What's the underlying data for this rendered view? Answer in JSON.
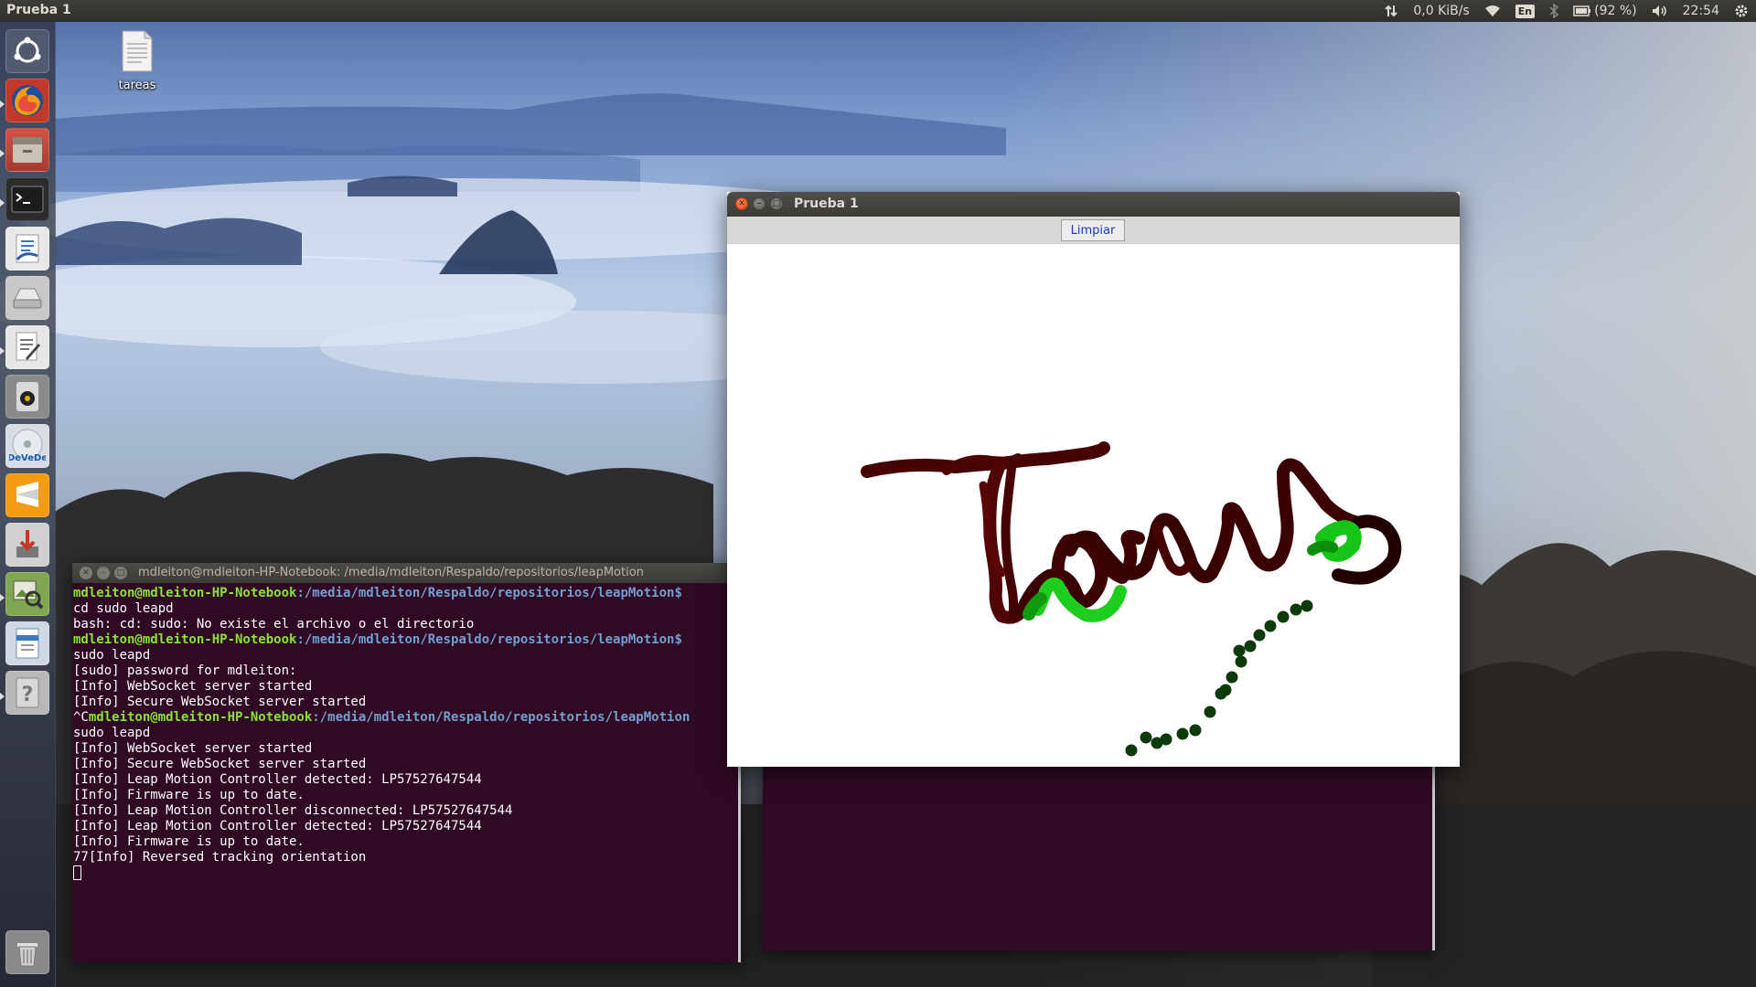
{
  "top_panel": {
    "app_title": "Prueba 1",
    "network_speed": "0,0 KiB/s",
    "keyboard_layout": "En",
    "battery_percent": "(92 %)",
    "clock": "22:54"
  },
  "launcher": {
    "items": [
      {
        "name": "dash-home-icon"
      },
      {
        "name": "firefox-icon",
        "running": true
      },
      {
        "name": "file-manager-icon",
        "running": true
      },
      {
        "name": "terminal-icon",
        "running": true
      },
      {
        "name": "text-editor-icon"
      },
      {
        "name": "drive-icon"
      },
      {
        "name": "writer-icon",
        "running": true
      },
      {
        "name": "speaker-app-icon"
      },
      {
        "name": "devede-icon"
      },
      {
        "name": "sublime-text-icon"
      },
      {
        "name": "installer-icon"
      },
      {
        "name": "image-viewer-icon",
        "running": true
      },
      {
        "name": "document-viewer-icon"
      },
      {
        "name": "help-icon",
        "running": true
      },
      {
        "name": "trash-icon"
      }
    ],
    "devede_label": "DeVeDe"
  },
  "desktop": {
    "file_label": "tareas"
  },
  "terminal": {
    "title": "mdleiton@mdleiton-HP-Notebook: /media/mdleiton/Respaldo/repositorios/leapMotion",
    "prompt_user": "mdleiton@mdleiton-HP-Notebook",
    "prompt_path": ":/media/mdleiton/Respaldo/repositorios/leapMotion$",
    "lines": [
      {
        "kind": "prompt",
        "pre": "",
        "user": "mdleiton@mdleiton-HP-Notebook",
        "path": ":/media/mdleiton/Respaldo/repositorios/leapMotion$"
      },
      {
        "kind": "text",
        "text": "cd sudo leapd"
      },
      {
        "kind": "text",
        "text": "bash: cd: sudo: No existe el archivo o el directorio"
      },
      {
        "kind": "prompt",
        "pre": "",
        "user": "mdleiton@mdleiton-HP-Notebook",
        "path": ":/media/mdleiton/Respaldo/repositorios/leapMotion$"
      },
      {
        "kind": "text",
        "text": "sudo leapd"
      },
      {
        "kind": "text",
        "text": "[sudo] password for mdleiton:"
      },
      {
        "kind": "text",
        "text": "[Info] WebSocket server started"
      },
      {
        "kind": "text",
        "text": "[Info] Secure WebSocket server started"
      },
      {
        "kind": "prompt",
        "pre": "^C",
        "user": "mdleiton@mdleiton-HP-Notebook",
        "path": ":/media/mdleiton/Respaldo/repositorios/leapMotion"
      },
      {
        "kind": "text",
        "text": "sudo leapd"
      },
      {
        "kind": "text",
        "text": "[Info] WebSocket server started"
      },
      {
        "kind": "text",
        "text": "[Info] Secure WebSocket server started"
      },
      {
        "kind": "text",
        "text": "[Info] Leap Motion Controller detected: LP57527647544"
      },
      {
        "kind": "text",
        "text": "[Info] Firmware is up to date."
      },
      {
        "kind": "text",
        "text": "[Info] Leap Motion Controller disconnected: LP57527647544"
      },
      {
        "kind": "text",
        "text": "[Info] Leap Motion Controller detected: LP57527647544"
      },
      {
        "kind": "text",
        "text": "[Info] Firmware is up to date."
      },
      {
        "kind": "text",
        "text": "77[Info] Reversed tracking orientation"
      }
    ],
    "colors": {
      "background": "#300a24",
      "user": "#8ae234",
      "path": "#729fcf",
      "text": "#ffffff"
    }
  },
  "app_window": {
    "title": "Prueba 1",
    "clear_button_label": "Limpiar",
    "stroke_colors": {
      "dark": "#4a0404",
      "bright": "#22dd22",
      "mid": "#0fae0f",
      "dots": "#0b3b0b"
    }
  }
}
